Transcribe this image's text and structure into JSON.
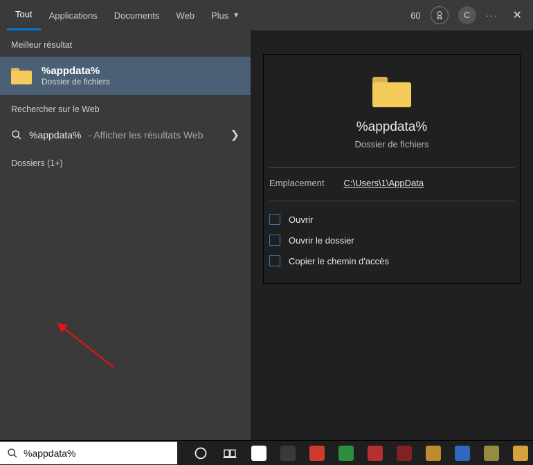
{
  "tabs": {
    "all": "Tout",
    "apps": "Applications",
    "docs": "Documents",
    "web": "Web",
    "more": "Plus"
  },
  "header": {
    "counter": "60",
    "avatar_initial": "C"
  },
  "left": {
    "best_label": "Meilleur résultat",
    "best_title": "%appdata%",
    "best_subtitle": "Dossier de fichiers",
    "web_label": "Rechercher sur le Web",
    "web_query": "%appdata%",
    "web_hint": "- Afficher les résultats Web",
    "folders_label": "Dossiers (1+)"
  },
  "detail": {
    "title": "%appdata%",
    "subtitle": "Dossier de fichiers",
    "location_label": "Emplacement",
    "location_value": "C:\\Users\\1\\AppData",
    "actions": {
      "open": "Ouvrir",
      "open_folder": "Ouvrir le dossier",
      "copy_path": "Copier le chemin d'accès"
    }
  },
  "search_input": "%appdata%",
  "taskbar_colors": [
    "#ffffff",
    "#3a3a3a",
    "#d03a2a",
    "#2d8f3c",
    "#b52f2f",
    "#7f2222",
    "#c08b2f",
    "#2f67c0",
    "#948c3e",
    "#d7a23b"
  ]
}
